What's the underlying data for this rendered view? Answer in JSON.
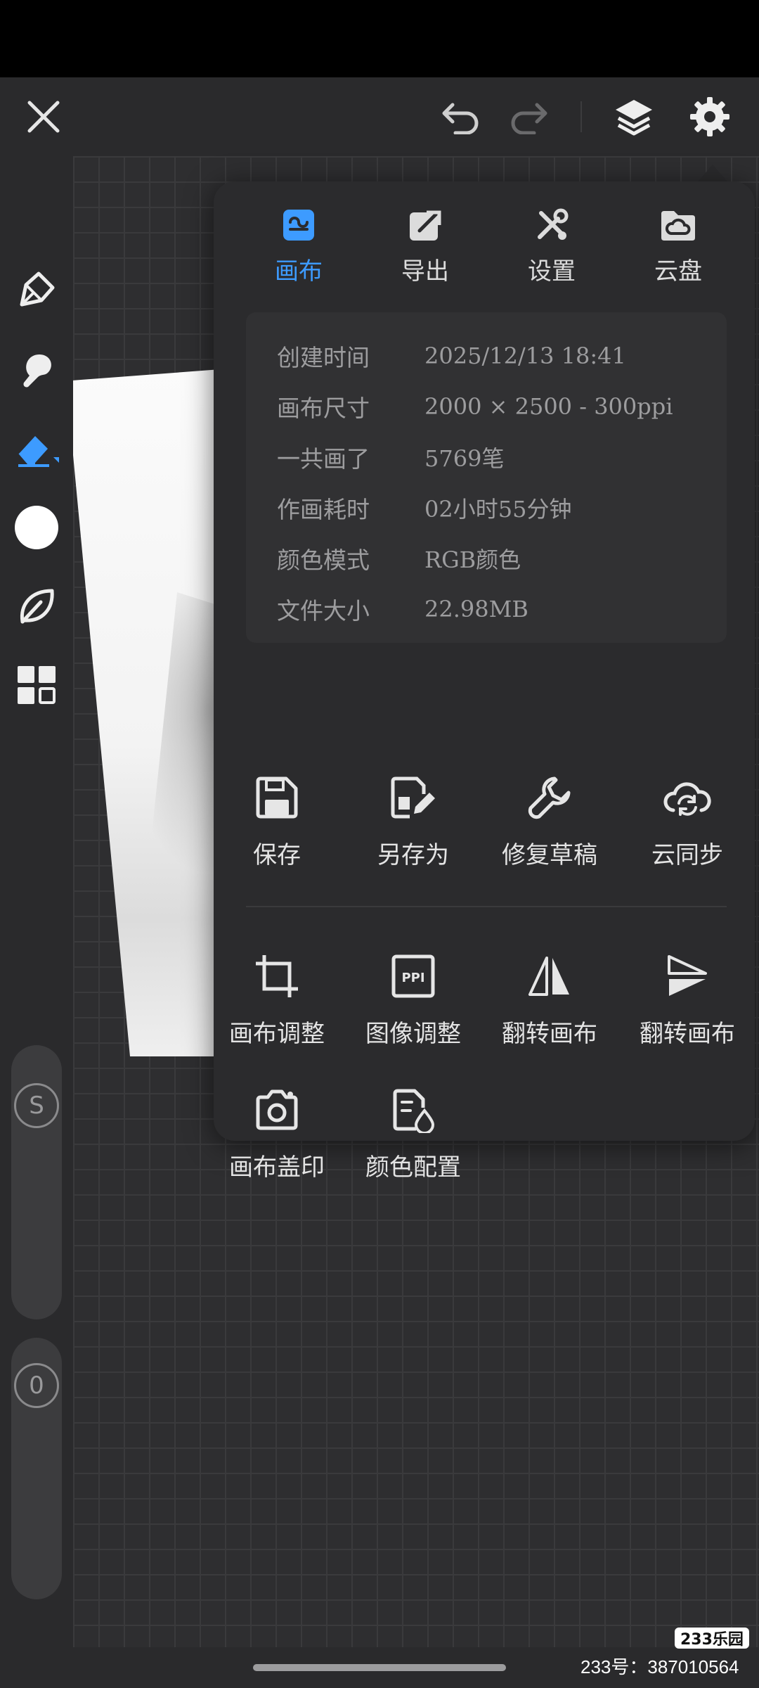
{
  "tabs": [
    {
      "label": "画布",
      "icon": "canvas-icon",
      "active": true
    },
    {
      "label": "导出",
      "icon": "export-icon",
      "active": false
    },
    {
      "label": "设置",
      "icon": "tools-icon",
      "active": false
    },
    {
      "label": "云盘",
      "icon": "cloud-folder-icon",
      "active": false
    }
  ],
  "info": [
    {
      "key": "创建时间",
      "value": "2025/12/13 18:41"
    },
    {
      "key": "画布尺寸",
      "value": "2000 × 2500 - 300ppi"
    },
    {
      "key": "一共画了",
      "value": "5769笔"
    },
    {
      "key": "作画耗时",
      "value": "02小时55分钟"
    },
    {
      "key": "颜色模式",
      "value": "RGB颜色"
    },
    {
      "key": "文件大小",
      "value": "22.98MB"
    }
  ],
  "actions_row1": [
    {
      "label": "保存",
      "icon": "save-icon"
    },
    {
      "label": "另存为",
      "icon": "save-as-icon"
    },
    {
      "label": "修复草稿",
      "icon": "wrench-icon"
    },
    {
      "label": "云同步",
      "icon": "cloud-sync-icon"
    }
  ],
  "actions_row2": [
    {
      "label": "画布调整",
      "icon": "crop-icon"
    },
    {
      "label": "图像调整",
      "icon": "ppi-icon"
    },
    {
      "label": "翻转画布",
      "icon": "flip-horizontal-icon"
    },
    {
      "label": "翻转画布",
      "icon": "flip-vertical-icon"
    }
  ],
  "actions_row3": [
    {
      "label": "画布盖印",
      "icon": "camera-icon"
    },
    {
      "label": "颜色配置",
      "icon": "color-profile-icon"
    }
  ],
  "sliders": {
    "size_label": "S",
    "opacity_label": "0"
  },
  "watermark": {
    "logo": "233乐园",
    "id": "233号：387010564"
  },
  "colors": {
    "accent": "#3d9bff",
    "background": "#2a2a2c",
    "popup": "#2b2b2d",
    "brush_color": "#ffffff"
  }
}
